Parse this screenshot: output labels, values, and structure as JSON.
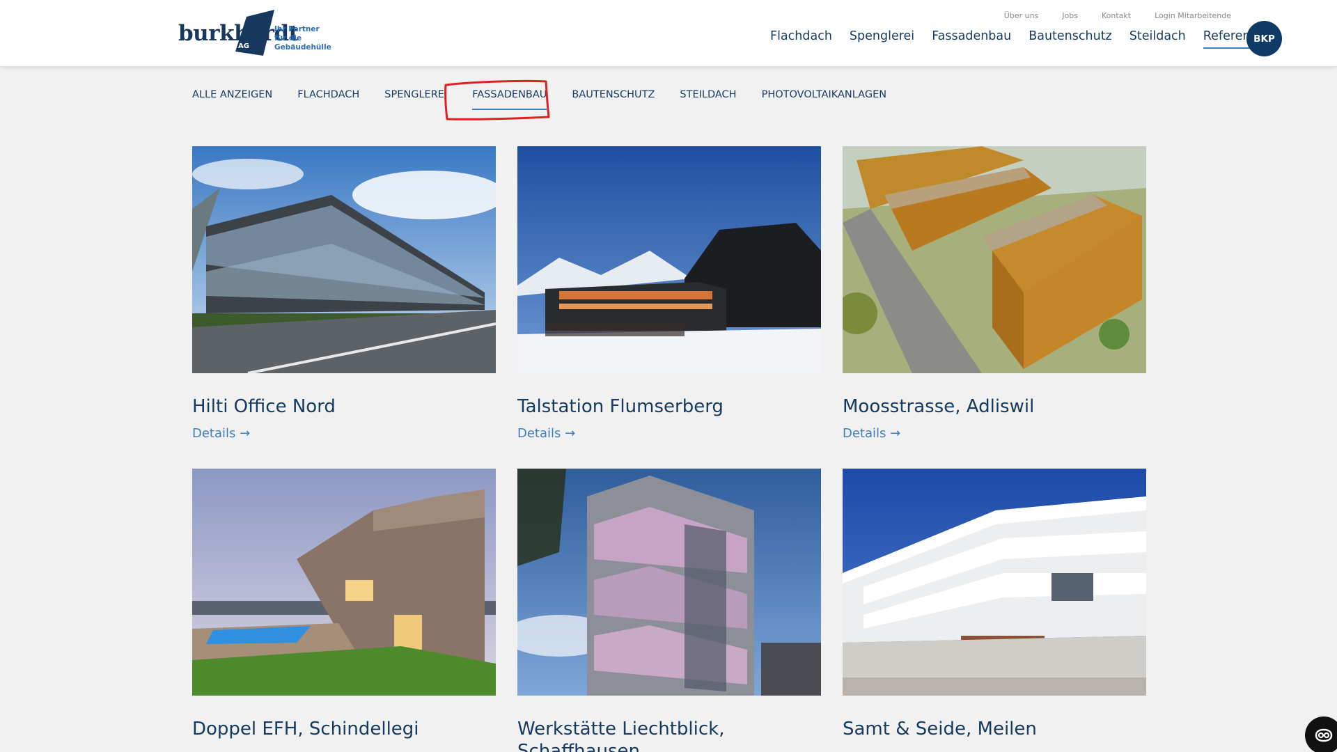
{
  "brand": {
    "name": "burkhardt",
    "suffix": "AG",
    "tagline_line1": "Ihr Partner",
    "tagline_line2": "für die Gebäudehülle"
  },
  "utility_nav": [
    "Über uns",
    "Jobs",
    "Kontakt",
    "Login Mitarbeitende"
  ],
  "main_nav": [
    "Flachdach",
    "Spenglerei",
    "Fassadenbau",
    "Bautenschutz",
    "Steildach",
    "Referenzen"
  ],
  "main_nav_active": "Referenzen",
  "avatar_label": "BKP",
  "filters": [
    "Alle anzeigen",
    "Flachdach",
    "Spenglerei",
    "Fassadenbau",
    "Bautenschutz",
    "Steildach",
    "Photovoltaikanlagen"
  ],
  "filter_active": "Fassadenbau",
  "details_label": "Details →",
  "cards": [
    {
      "title": "Hilti Office Nord"
    },
    {
      "title": "Talstation Flumserberg"
    },
    {
      "title": "Moosstrasse, Adliswil"
    },
    {
      "title": "Doppel EFH, Schindellegi"
    },
    {
      "title": "Werkstätte Liechtblick, Schaffhausen"
    },
    {
      "title": "Samt & Seide, Meilen"
    }
  ],
  "colors": {
    "navy": "#163a5f",
    "accent": "#3d7fc2",
    "highlight": "#e02020",
    "background": "#f1f1f1"
  }
}
